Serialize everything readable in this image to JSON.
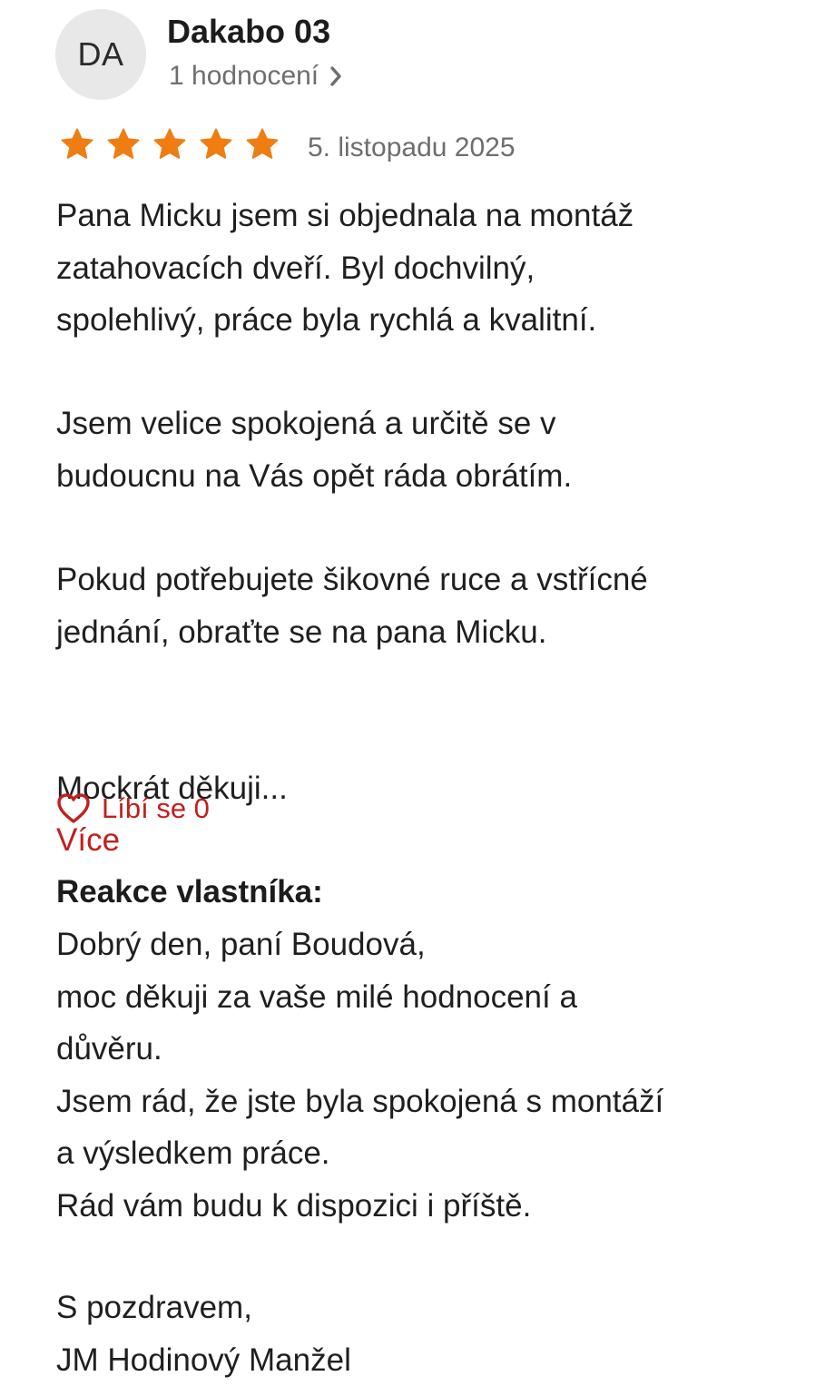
{
  "reviewer": {
    "initials": "DA",
    "name": "Dakabo 03",
    "ratings_count_label": "1 hodnocení"
  },
  "rating": {
    "stars": 5,
    "max_stars": 5,
    "star_color": "#f07d12"
  },
  "date": "5. listopadu 2025",
  "review": {
    "paragraph_1": "Pana Micku jsem si objednala na montáž\nzatahovacích dveří. Byl dochvilný,\nspolehlivý, práce byla rychlá a kvalitní.",
    "paragraph_2": "Jsem velice spokojená a určitě se v\nbudoucnu na Vás opět ráda obrátím.",
    "paragraph_3": "Pokud potřebujete šikovné ruce a vstřícné\njednání, obraťte se na pana Micku.",
    "paragraph_4": "Mockrát děkuji...",
    "more_label": "Více"
  },
  "like": {
    "label": "Líbí se 0",
    "color": "#c0201f"
  },
  "owner_response": {
    "heading": "Reakce vlastníka:",
    "body": "Dobrý den, paní Boudová,\nmoc děkuji za vaše milé hodnocení a\ndůvěru.\nJsem rád, že jste byla spokojená s montáží\na výsledkem práce.\nRád vám budu k dispozici i příště.",
    "closing": "S pozdravem,\nJM Hodinový Manžel"
  }
}
